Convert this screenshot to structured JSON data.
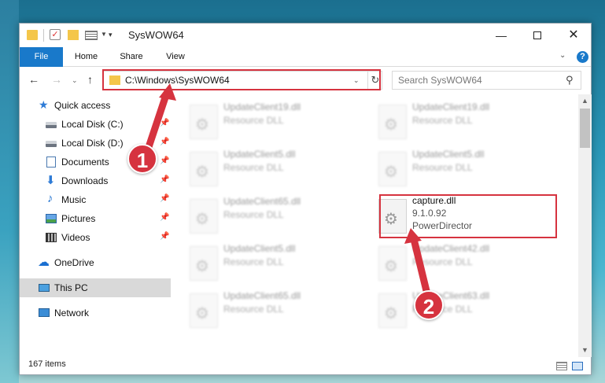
{
  "window": {
    "title": "SysWOW64",
    "controls": {
      "minimize": "—",
      "close": "✕"
    }
  },
  "quick_access_toolbar": {
    "check_glyph": "✓",
    "dropdown_glyph": "▼",
    "customize_glyph": "▾"
  },
  "ribbon": {
    "tabs": [
      {
        "label": "File",
        "active": true
      },
      {
        "label": "Home"
      },
      {
        "label": "Share"
      },
      {
        "label": "View"
      }
    ],
    "collapse_glyph": "⌄",
    "help_glyph": "?"
  },
  "navigation": {
    "back_glyph": "←",
    "forward_glyph": "→",
    "recent_glyph": "⌄",
    "up_glyph": "↑",
    "address": "C:\\Windows\\SysWOW64",
    "address_chevron": "⌄",
    "refresh_glyph": "↻",
    "search_placeholder": "Search SysWOW64",
    "search_glyph": "⚲"
  },
  "sidebar": {
    "items": [
      {
        "label": "Quick access",
        "icon": "star-icon"
      },
      {
        "label": "Local Disk (C:)",
        "icon": "drive-icon",
        "pinned": true
      },
      {
        "label": "Local Disk (D:)",
        "icon": "drive-icon",
        "pinned": true
      },
      {
        "label": "Documents",
        "icon": "documents-icon",
        "pinned": true
      },
      {
        "label": "Downloads",
        "icon": "downloads-icon",
        "pinned": true
      },
      {
        "label": "Music",
        "icon": "music-icon",
        "pinned": true
      },
      {
        "label": "Pictures",
        "icon": "pictures-icon",
        "pinned": true
      },
      {
        "label": "Videos",
        "icon": "videos-icon",
        "pinned": true
      },
      {
        "label": "OneDrive",
        "icon": "cloud-icon"
      },
      {
        "label": "This PC",
        "icon": "pc-icon",
        "selected": true
      },
      {
        "label": "Network",
        "icon": "network-icon"
      }
    ],
    "pin_glyph": "📌",
    "glyphs": {
      "star": "★",
      "down": "⬇",
      "music": "♪",
      "cloud": "☁"
    }
  },
  "files": {
    "gear_glyph": "⚙",
    "items": [
      {
        "name": "UpdateClient19.dll",
        "type": "Resource DLL"
      },
      {
        "name": "UpdateClient19.dll",
        "type": "Resource DLL"
      },
      {
        "name": "UpdateClient5.dll",
        "type": "Resource DLL"
      },
      {
        "name": "UpdateClient5.dll",
        "type": "Resource DLL"
      },
      {
        "name": "UpdateClient65.dll",
        "type": "Resource DLL"
      },
      {
        "name": "capture.dll",
        "type": "9.1.0.92",
        "extra": "PowerDirector",
        "highlighted": true
      },
      {
        "name": "UpdateClient5.dll",
        "type": "Resource DLL"
      },
      {
        "name": "UpdateClient42.dll",
        "type": "Resource DLL"
      },
      {
        "name": "UpdateClient65.dll",
        "type": "Resource DLL"
      },
      {
        "name": "UpdateClient63.dll",
        "type": "Resource DLL"
      }
    ]
  },
  "scrollbar": {
    "up_glyph": "▲",
    "down_glyph": "▼"
  },
  "status": {
    "item_count": "167 items"
  },
  "annotations": {
    "callout_1": "1",
    "callout_2": "2",
    "color": "#d6333f"
  }
}
